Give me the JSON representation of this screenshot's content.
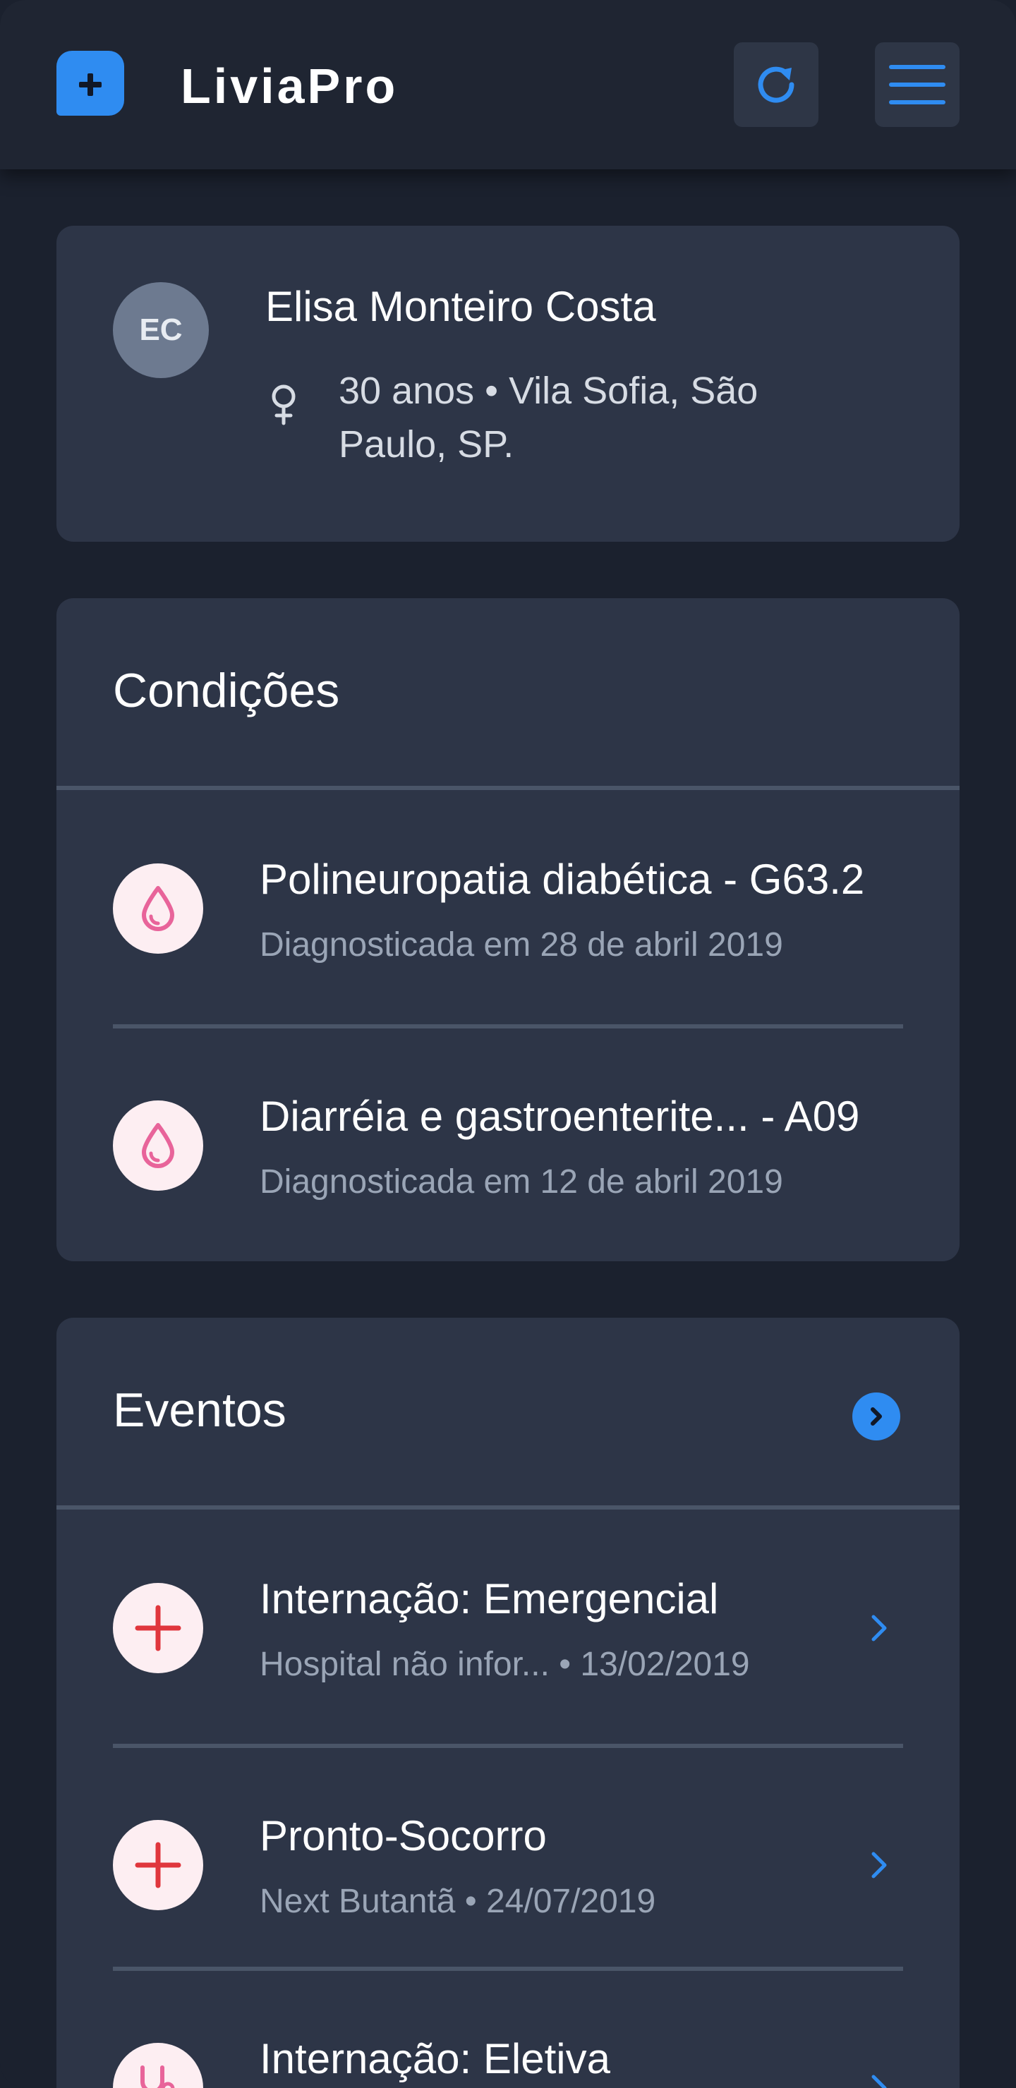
{
  "header": {
    "brand": "LiviaPro",
    "logo_icon": "plus-chat-icon",
    "refresh_icon": "refresh-icon",
    "menu_icon": "hamburger-menu-icon",
    "accent_color": "#2f8cf1"
  },
  "patient": {
    "initials": "EC",
    "name": "Elisa Monteiro Costa",
    "gender_icon": "female-icon",
    "info": "30 anos • Vila Sofia, São Paulo, SP."
  },
  "conditions": {
    "title": "Condições",
    "items": [
      {
        "icon": "blood-drop-icon",
        "title": "Polineuropatia diabética - G63.2",
        "subtitle": "Diagnosticada em 28 de abril 2019"
      },
      {
        "icon": "blood-drop-icon",
        "title": "Diarréia e gastroenterite... - A09",
        "subtitle": "Diagnosticada em 12 de abril 2019"
      }
    ]
  },
  "events": {
    "title": "Eventos",
    "items": [
      {
        "icon": "medical-cross-icon",
        "title": "Internação: Emergencial",
        "subtitle": "Hospital não infor... • 13/02/2019"
      },
      {
        "icon": "medical-cross-icon",
        "title": "Pronto-Socorro",
        "subtitle": "Next Butantã • 24/07/2019"
      },
      {
        "icon": "stethoscope-icon",
        "title": "Internação: Eletiva",
        "subtitle": ""
      }
    ]
  }
}
